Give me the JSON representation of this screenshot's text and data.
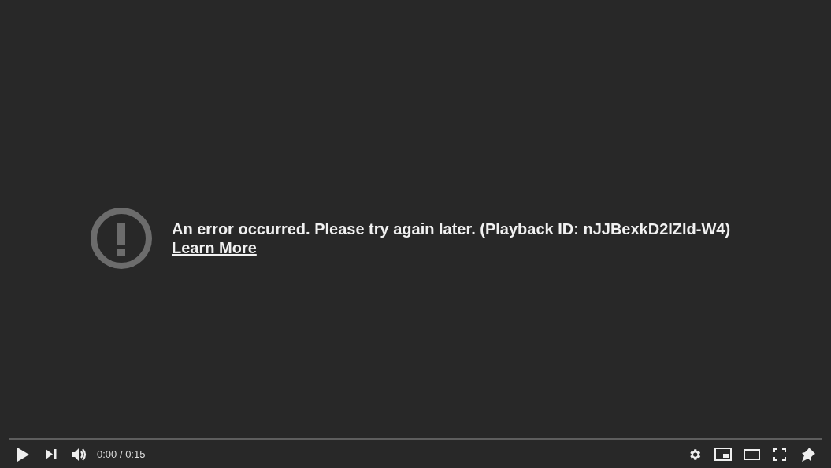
{
  "error": {
    "message": "An error occurred. Please try again later. (Playback ID: nJJBexkD2IZld-W4)",
    "link": "Learn More"
  },
  "progress": {
    "level": 0
  },
  "time": "0:00 / 0:15"
}
